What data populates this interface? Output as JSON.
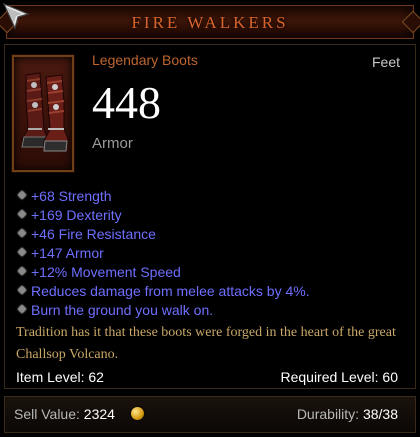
{
  "item": {
    "name": "FIRE WALKERS",
    "type": "Legendary Boots",
    "slot": "Feet",
    "armor_value": "448",
    "armor_label": "Armor",
    "icon": "boots-icon"
  },
  "stats": [
    "+68 Strength",
    "+169 Dexterity",
    "+46 Fire Resistance",
    "+147 Armor",
    "+12% Movement Speed",
    "Reduces damage from melee attacks by 4%.",
    "Burn the ground you walk on."
  ],
  "flavor": "Tradition has it that these boots were forged in the heart of the great Challsop Volcano.",
  "levels": {
    "item_level_label": "Item Level:",
    "item_level": "62",
    "required_level_label": "Required Level:",
    "required_level": "60"
  },
  "footer": {
    "sell_label": "Sell Value:",
    "sell_value": "2324",
    "durability_label": "Durability:",
    "durability_value": "38/38"
  },
  "colors": {
    "title": "#d8642c",
    "item_type": "#bf642f",
    "magic_stat": "#6e6fff",
    "flavor": "#c9a867"
  }
}
